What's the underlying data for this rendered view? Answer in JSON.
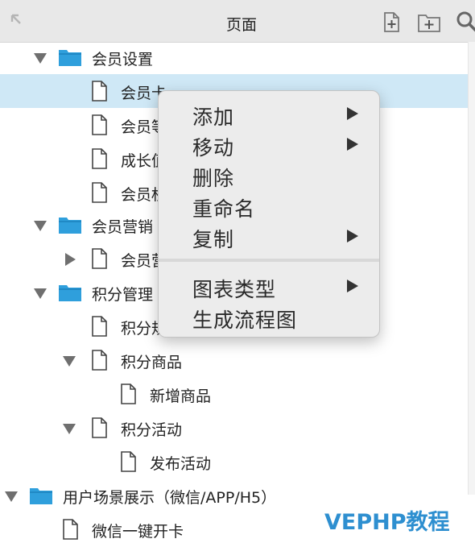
{
  "header": {
    "title": "页面"
  },
  "tree": {
    "rows": [
      {
        "label": "会员设置",
        "type": "folder",
        "disclosure": "expanded",
        "selected": false
      },
      {
        "label": "会员卡",
        "type": "page",
        "disclosure": "none",
        "selected": true
      },
      {
        "label": "会员等",
        "type": "page",
        "disclosure": "none",
        "selected": false
      },
      {
        "label": "成长值",
        "type": "page",
        "disclosure": "none",
        "selected": false
      },
      {
        "label": "会员权",
        "type": "page",
        "disclosure": "none",
        "selected": false
      },
      {
        "label": "会员营销",
        "type": "folder",
        "disclosure": "expanded",
        "selected": false
      },
      {
        "label": "会员营",
        "type": "page",
        "disclosure": "collapsed",
        "selected": false
      },
      {
        "label": "积分管理",
        "type": "folder",
        "disclosure": "expanded",
        "selected": false
      },
      {
        "label": "积分规",
        "type": "page",
        "disclosure": "none",
        "selected": false
      },
      {
        "label": "积分商品",
        "type": "page",
        "disclosure": "expanded",
        "selected": false
      },
      {
        "label": "新增商品",
        "type": "page",
        "disclosure": "none",
        "selected": false
      },
      {
        "label": "积分活动",
        "type": "page",
        "disclosure": "expanded",
        "selected": false
      },
      {
        "label": "发布活动",
        "type": "page",
        "disclosure": "none",
        "selected": false
      },
      {
        "label": "用户场景展示（微信/APP/H5）",
        "type": "folder",
        "disclosure": "expanded",
        "selected": false
      },
      {
        "label": "微信一键开卡",
        "type": "page",
        "disclosure": "none",
        "selected": false
      }
    ]
  },
  "context_menu": {
    "items": [
      {
        "label": "添加",
        "submenu": true
      },
      {
        "label": "移动",
        "submenu": true
      },
      {
        "label": "删除",
        "submenu": false
      },
      {
        "label": "重命名",
        "submenu": false
      },
      {
        "label": "复制",
        "submenu": true
      },
      {
        "label": "图表类型",
        "submenu": true
      },
      {
        "label": "生成流程图",
        "submenu": false
      }
    ]
  },
  "watermark": {
    "text": "VEPHP教程"
  },
  "colors": {
    "folder": "#2f9fdc",
    "selected_row": "#cfe8f6",
    "watermark": "#2e8fd0"
  }
}
